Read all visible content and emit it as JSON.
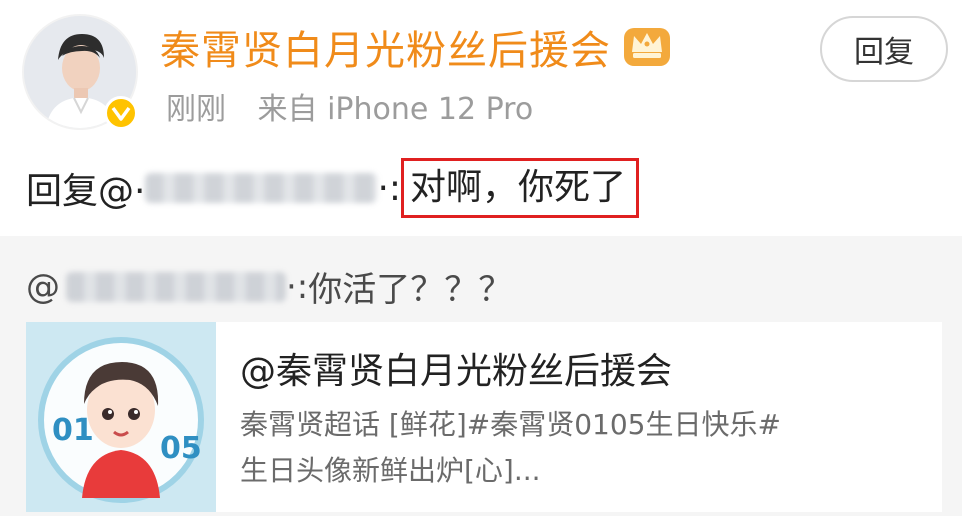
{
  "post": {
    "username": "秦霄贤白月光粉丝后援会",
    "time": "刚刚",
    "source": "来自 iPhone 12 Pro",
    "reply_button": "回复",
    "reply_prefix": "回复@·",
    "reply_separator": "·:",
    "reply_text": "对啊，你死了"
  },
  "quote": {
    "prefix": "@",
    "separator": "·:",
    "text": "你活了？？？",
    "card_title": "@秦霄贤白月光粉丝后援会",
    "card_line1": "秦霄贤超话 [鲜花]#秦霄贤0105生日快乐#",
    "card_line2": "生日头像新鲜出炉[心]..."
  },
  "thumb_text": {
    "left": "01",
    "right": "05"
  },
  "colors": {
    "username": "#f08b1a",
    "highlight_border": "#e02020",
    "verified_badge": "#ffc300"
  },
  "icons": [
    "avatar-photo",
    "verified-badge-icon",
    "crown-icon",
    "blurred-username",
    "cartoon-thumbnail"
  ]
}
